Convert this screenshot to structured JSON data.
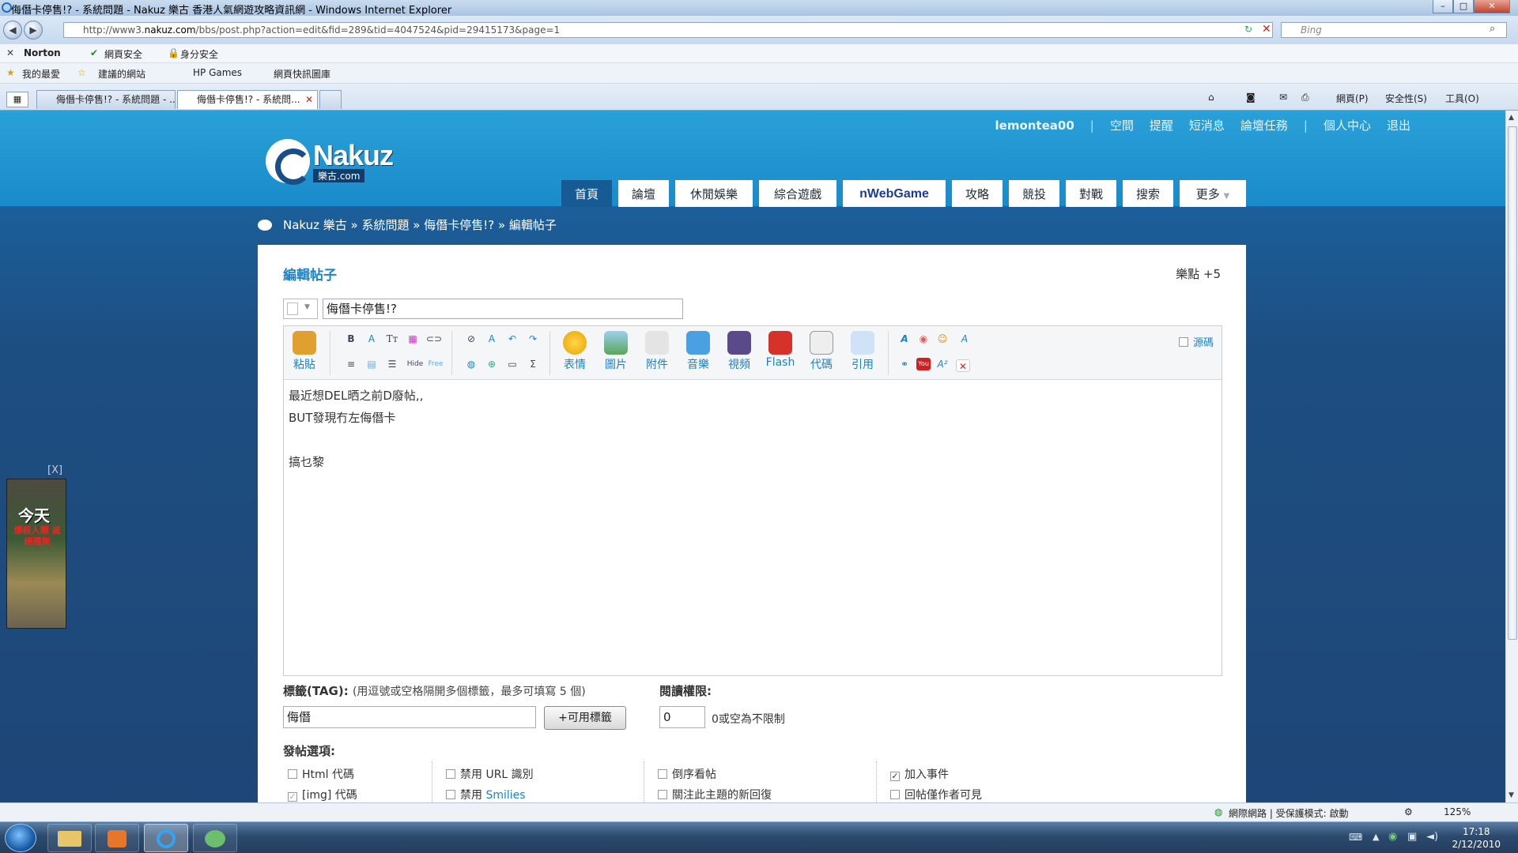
{
  "window": {
    "title": "侮僭卡停售!? - 系統問題 - Nakuz 樂古 香港人氣網遊攻略資訊網 - Windows Internet Explorer"
  },
  "browser": {
    "url_prefix": "http://www3.",
    "url_domain": "nakuz.com",
    "url_rest": "/bbs/post.php?action=edit&fid=289&tid=4047524&pid=29415173&page=1",
    "search_placeholder": "Bing",
    "norton_label": "Norton",
    "web_safety": "網頁安全",
    "identity_safety": "身分安全",
    "favorites": "我的最愛",
    "suggested_sites": "建議的網站",
    "hp_games": "HP Games",
    "web_slice": "網頁快訊圖庫",
    "tabs": [
      {
        "label": "侮僭卡停售!? - 系統問題 - ..."
      },
      {
        "label": "侮僭卡停售!? - 系統問..."
      }
    ],
    "cmd_page": "網頁(P)",
    "cmd_safety": "安全性(S)",
    "cmd_tools": "工具(O)"
  },
  "site": {
    "logo_text": "Nakuz",
    "logo_sub": "樂古.com",
    "user_nav": [
      "lemontea00",
      "空間",
      "提醒",
      "短消息",
      "論壇任務",
      "個人中心",
      "退出"
    ],
    "main_nav": [
      "首頁",
      "論壇",
      "休閒娛樂",
      "綜合遊戲",
      "nWebGame",
      "攻略",
      "競投",
      "對戰",
      "搜索",
      "更多"
    ],
    "breadcrumb": "Nakuz 樂古 » 系統問題 » 侮僭卡停售!? » 編輯帖子"
  },
  "form": {
    "title": "編輯帖子",
    "points": "樂點 +5",
    "subject": "侮僭卡停售!?",
    "source_label": "源碼",
    "tool_labels": {
      "paste": "粘貼",
      "emoticon": "表情",
      "image": "圖片",
      "attachment": "附件",
      "music": "音樂",
      "video": "視頻",
      "flash": "Flash",
      "code": "代碼",
      "quote": "引用",
      "hide": "Hide",
      "free": "Free"
    },
    "content_lines": [
      "最近想DEL晒之前D廢帖,,",
      "BUT發現冇左侮僭卡",
      "",
      "搞乜黎"
    ],
    "tag_label": "標籤(TAG):",
    "tag_hint": "(用逗號或空格隔開多個標籤，最多可填寫 5 個)",
    "tag_value": "侮僭",
    "tag_button": "+可用標籤",
    "read_perm_label": "閱讀權限:",
    "read_perm_value": "0",
    "read_perm_hint": "0或空為不限制",
    "options_label": "發帖選項:",
    "options": [
      {
        "label": "Html 代碼",
        "checked": false
      },
      {
        "label": "禁用 URL 識別",
        "checked": false
      },
      {
        "label": "倒序看帖",
        "checked": false
      },
      {
        "label": "加入事件",
        "checked": true
      },
      {
        "label": "[img] 代碼",
        "checked": true
      },
      {
        "label": "禁用 ",
        "link": "Smilies",
        "checked": false
      },
      {
        "label": "關注此主題的新回復",
        "checked": false
      },
      {
        "label": "回帖僅作者可見",
        "checked": false
      }
    ]
  },
  "ad": {
    "close": "[X]",
    "text": "今天",
    "sub": "爆殺人類 滅絕殭屍"
  },
  "status": {
    "zone": "網際網路 | 受保護模式: 啟動",
    "zoom": "125%"
  },
  "clock": {
    "time": "17:18",
    "date": "2/12/2010"
  }
}
